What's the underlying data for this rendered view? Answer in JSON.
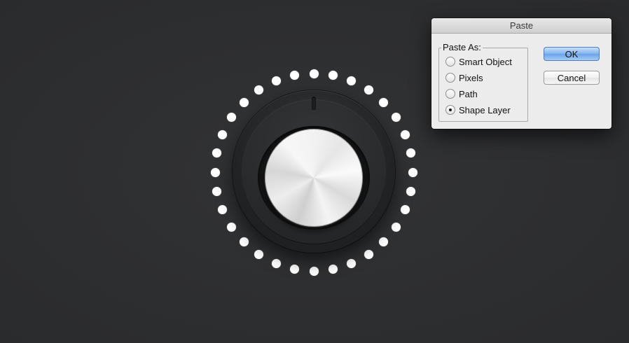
{
  "dialog": {
    "title": "Paste",
    "group_label": "Paste As:",
    "options": [
      {
        "label": "Smart Object",
        "selected": false
      },
      {
        "label": "Pixels",
        "selected": false
      },
      {
        "label": "Path",
        "selected": false
      },
      {
        "label": "Shape Layer",
        "selected": true
      }
    ],
    "ok_label": "OK",
    "cancel_label": "Cancel"
  },
  "canvas": {
    "background_color": "#2e2f31",
    "dot_color": "#ffffff",
    "dot_count": 32
  },
  "colors": {
    "ok_button": "#7fb3ee",
    "dialog_bg": "#ececec"
  }
}
